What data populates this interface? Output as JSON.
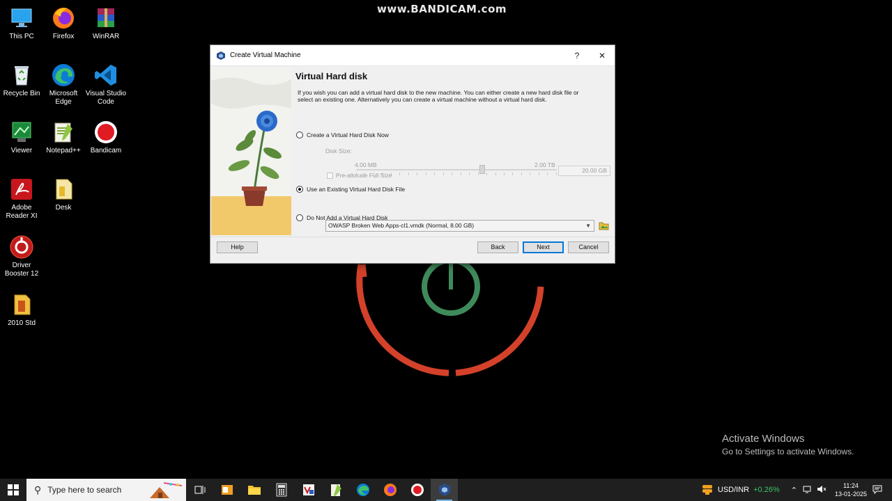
{
  "watermark": "www.BANDICAM.com",
  "desktop_icons": [
    {
      "id": "this-pc",
      "label": "This PC",
      "icon": "monitor-icon"
    },
    {
      "id": "firefox",
      "label": "Firefox",
      "icon": "firefox-icon"
    },
    {
      "id": "winrar",
      "label": "WinRAR",
      "icon": "winrar-icon"
    },
    {
      "id": "recycle-bin",
      "label": "Recycle Bin",
      "icon": "recycle-bin-icon"
    },
    {
      "id": "edge",
      "label": "Microsoft Edge",
      "icon": "edge-icon"
    },
    {
      "id": "vscode",
      "label": "Visual Studio Code",
      "icon": "vscode-icon"
    },
    {
      "id": "viewer",
      "label": "Viewer",
      "icon": "viewer-icon"
    },
    {
      "id": "notepadpp",
      "label": "Notepad++",
      "icon": "notepadpp-icon"
    },
    {
      "id": "bandicam",
      "label": "Bandicam",
      "icon": "bandicam-icon"
    },
    {
      "id": "adobe",
      "label": "Adobe Reader XI",
      "icon": "adobe-reader-icon"
    },
    {
      "id": "desk",
      "label": "Desk",
      "icon": "file-icon"
    },
    {
      "id": "driver-booster",
      "label": "Driver Booster 12",
      "icon": "driver-booster-icon"
    },
    {
      "id": "2010-std",
      "label": "2010 Std",
      "icon": "file-icon"
    }
  ],
  "dialog": {
    "title": "Create Virtual Machine",
    "help_glyph": "?",
    "close_glyph": "✕",
    "heading": "Virtual Hard disk",
    "description": "If you wish you can add a virtual hard disk to the new machine. You can either create a new hard disk file or select an existing one. Alternatively you can create a virtual machine without a virtual hard disk.",
    "options": {
      "create_new": {
        "label": "Create a Virtual Hard Disk Now",
        "selected": false
      },
      "use_existing": {
        "label": "Use an Existing Virtual Hard Disk File",
        "selected": true
      },
      "none": {
        "label": "Do Not Add a Virtual Hard Disk",
        "selected": false
      }
    },
    "disk_size_label": "Disk Size:",
    "disk_size_value": "20.00 GB",
    "slider_min": "4.00 MB",
    "slider_max": "2.00 TB",
    "preallocate_label": "Pre-allocate Full Size",
    "existing_file": "OWASP Broken Web Apps-cl1.vmdk (Normal, 8.00 GB)",
    "buttons": {
      "help": "Help",
      "back": "Back",
      "next": "Next",
      "cancel": "Cancel"
    }
  },
  "activate": {
    "line1": "Activate Windows",
    "line2": "Go to Settings to activate Windows."
  },
  "taskbar": {
    "search_placeholder": "Type here to search",
    "currency": "USD/INR",
    "currency_change": "+0.26%",
    "currency_change_color": "#3cc46a",
    "time": "11:24",
    "date": "13-01-2025"
  }
}
